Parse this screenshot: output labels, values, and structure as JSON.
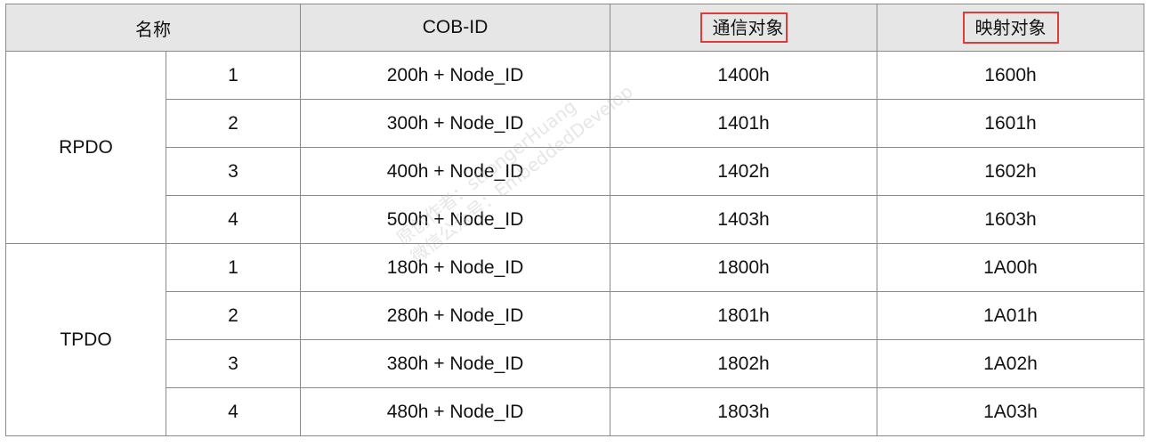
{
  "table": {
    "headers": {
      "name": "名称",
      "cob_id": "COB-ID",
      "comm_object": "通信对象",
      "map_object": "映射对象"
    },
    "groups": [
      {
        "name": "RPDO",
        "rows": [
          {
            "index": "1",
            "cob_id": "200h + Node_ID",
            "comm": "1400h",
            "map": "1600h"
          },
          {
            "index": "2",
            "cob_id": "300h + Node_ID",
            "comm": "1401h",
            "map": "1601h"
          },
          {
            "index": "3",
            "cob_id": "400h + Node_ID",
            "comm": "1402h",
            "map": "1602h"
          },
          {
            "index": "4",
            "cob_id": "500h + Node_ID",
            "comm": "1403h",
            "map": "1603h"
          }
        ]
      },
      {
        "name": "TPDO",
        "rows": [
          {
            "index": "1",
            "cob_id": "180h + Node_ID",
            "comm": "1800h",
            "map": "1A00h"
          },
          {
            "index": "2",
            "cob_id": "280h + Node_ID",
            "comm": "1801h",
            "map": "1A01h"
          },
          {
            "index": "3",
            "cob_id": "380h + Node_ID",
            "comm": "1802h",
            "map": "1A02h"
          },
          {
            "index": "4",
            "cob_id": "480h + Node_ID",
            "comm": "1803h",
            "map": "1A03h"
          }
        ]
      }
    ]
  },
  "highlight_color": "#e03a3a",
  "watermark": {
    "line1": "原创作者：strongerHuang",
    "line2": "微信公众号：EmbeddedDevelop"
  }
}
